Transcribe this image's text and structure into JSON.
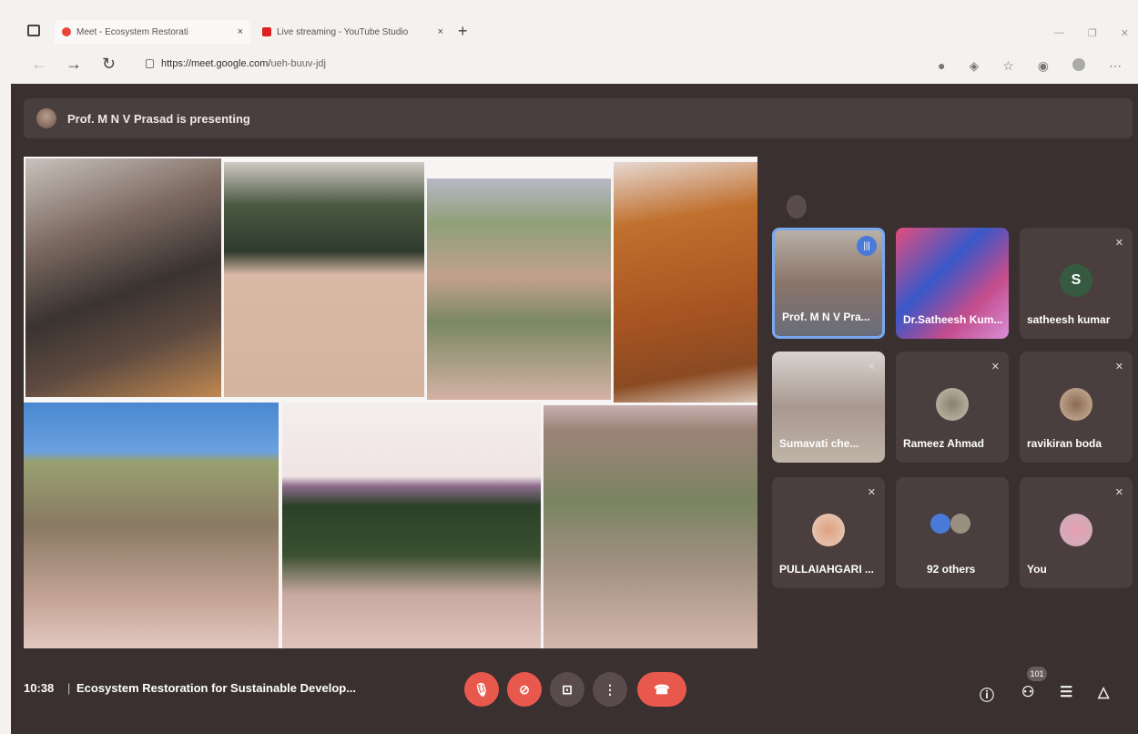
{
  "browser": {
    "tabs": [
      {
        "label": "Meet - Ecosystem Restorati",
        "close": "×"
      },
      {
        "label": "Live streaming - YouTube Studio",
        "close": "×"
      }
    ],
    "new_tab": "+",
    "url_host": "https://meet.google.com/",
    "url_path": "ueh-buuv-jdj",
    "tools": [
      "☆",
      "⋯"
    ]
  },
  "meet": {
    "presenting_text": "Prof. M N V Prasad is presenting",
    "participants": [
      {
        "name": "Prof. M N V Pra..."
      },
      {
        "name": "Dr.Satheesh Kum..."
      },
      {
        "name": "satheesh kumar",
        "initial": "S"
      },
      {
        "name": "Sumavati che..."
      },
      {
        "name": "Rameez Ahmad"
      },
      {
        "name": "ravikiran boda"
      },
      {
        "name": "PULLAIAHGARI ..."
      },
      {
        "name": "92 others"
      },
      {
        "name": "You"
      }
    ],
    "time": "10:38",
    "meeting_title": "Ecosystem Restoration for Sustainable Develop...",
    "participant_count": "101"
  }
}
